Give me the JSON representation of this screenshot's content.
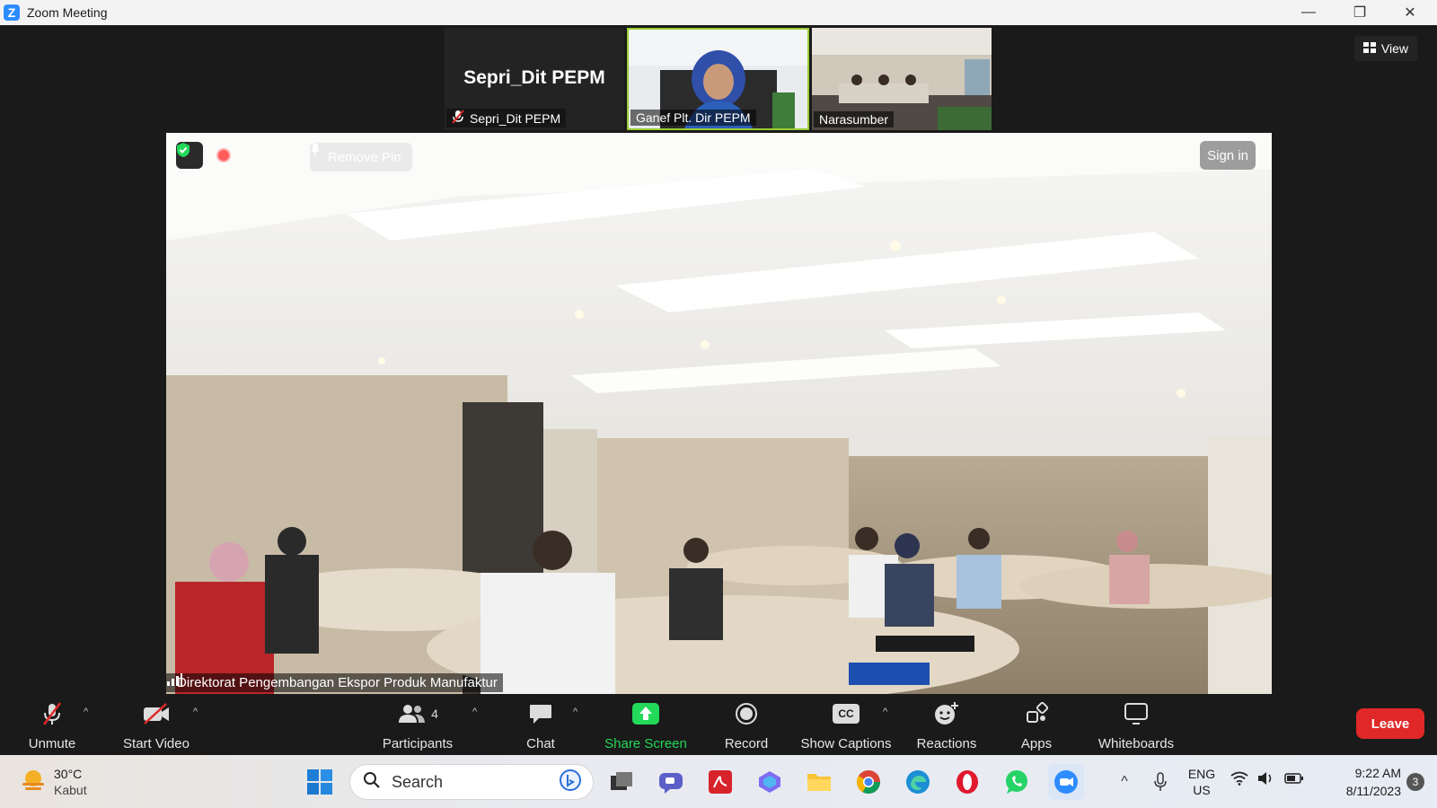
{
  "window": {
    "title": "Zoom Meeting",
    "logo_letter": "Z",
    "minimize_glyph": "—",
    "restore_glyph": "❐",
    "close_glyph": "✕"
  },
  "view_button": {
    "label": "View",
    "icon": "grid-view-icon"
  },
  "thumbnails": [
    {
      "display_name": "Sepri_Dit PEPM",
      "label": "Sepri_Dit PEPM",
      "muted": true,
      "active_speaker": false
    },
    {
      "label": "Ganef Plt. Dir PEPM",
      "muted": false,
      "active_speaker": true
    },
    {
      "label": "Narasumber",
      "muted": false,
      "active_speaker": false
    }
  ],
  "main_video": {
    "participant_label": "Direktorat Pengembangan Ekspor Produk Manufaktur",
    "remove_pin_label": "Remove Pin",
    "sign_in_label": "Sign in",
    "pinned": true,
    "recording": true,
    "encrypted": true
  },
  "toolbar": {
    "unmute": "Unmute",
    "start_video": "Start Video",
    "participants": "Participants",
    "participants_count": "4",
    "chat": "Chat",
    "share_screen": "Share Screen",
    "record": "Record",
    "show_captions": "Show Captions",
    "cc_glyph": "CC",
    "reactions": "Reactions",
    "apps": "Apps",
    "whiteboards": "Whiteboards",
    "leave": "Leave",
    "caret_glyph": "^"
  },
  "taskbar": {
    "weather_temp": "30°C",
    "weather_desc": "Kabut",
    "search_placeholder": "Search",
    "language_top": "ENG",
    "language_bottom": "US",
    "time": "9:22 AM",
    "date": "8/11/2023",
    "notification_count": "3",
    "tray_chevron_glyph": "^"
  },
  "colors": {
    "accent_green": "#23d959",
    "leave_red": "#e02828",
    "active_speaker_border": "#9acd32",
    "zoom_blue": "#2d8cff"
  }
}
